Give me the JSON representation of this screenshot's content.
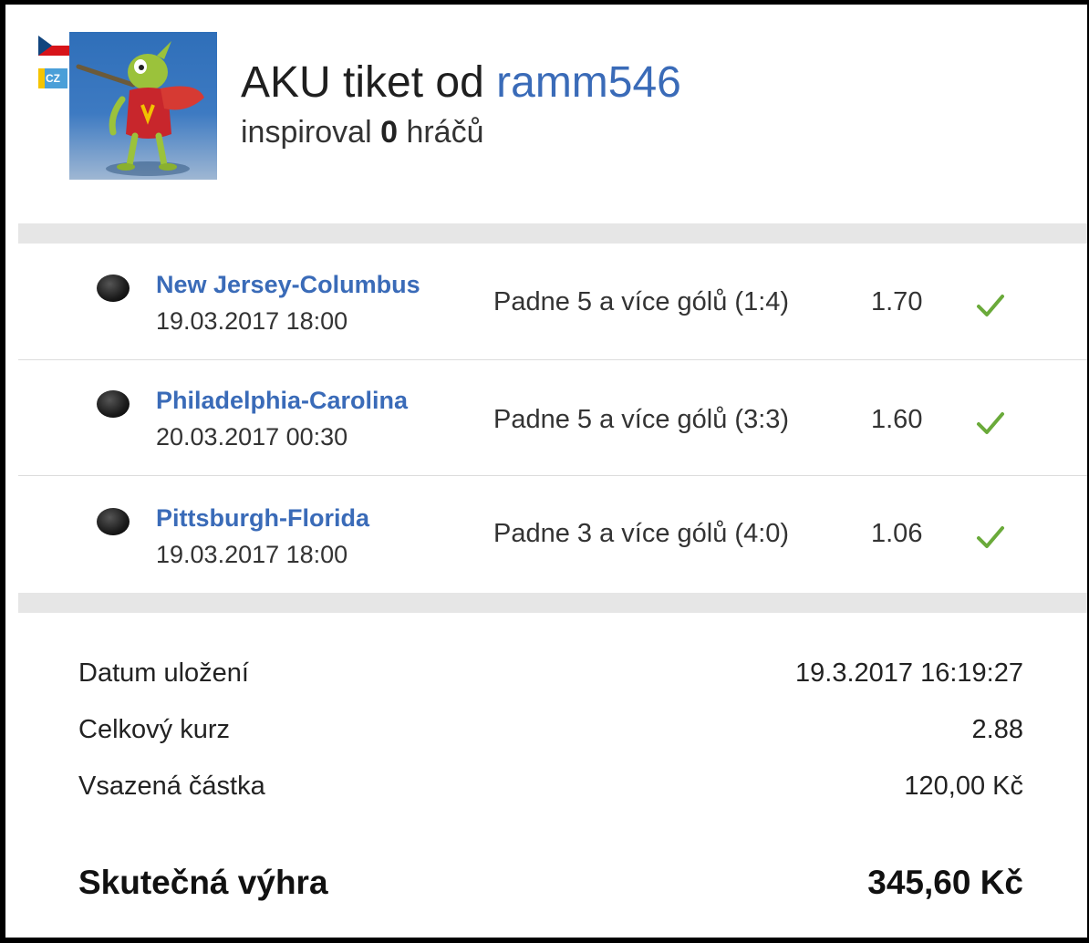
{
  "header": {
    "country_badge": "CZ",
    "title_prefix": "AKU tiket od",
    "username": "ramm546",
    "inspired_prefix": "inspiroval",
    "inspired_count": "0",
    "inspired_suffix": "hráčů"
  },
  "bets": [
    {
      "match": "New Jersey-Columbus",
      "datetime": "19.03.2017 18:00",
      "market": "Padne 5 a více gólů (1:4)",
      "odd": "1.70",
      "status_icon": "check-icon"
    },
    {
      "match": "Philadelphia-Carolina",
      "datetime": "20.03.2017 00:30",
      "market": "Padne 5 a více gólů (3:3)",
      "odd": "1.60",
      "status_icon": "check-icon"
    },
    {
      "match": "Pittsburgh-Florida",
      "datetime": "19.03.2017 18:00",
      "market": "Padne 3 a více gólů (4:0)",
      "odd": "1.06",
      "status_icon": "check-icon"
    }
  ],
  "summary": {
    "saved_date_label": "Datum uložení",
    "saved_date_value": "19.3.2017 16:19:27",
    "total_odds_label": "Celkový kurz",
    "total_odds_value": "2.88",
    "stake_label": "Vsazená částka",
    "stake_value": "120,00 Kč",
    "win_label": "Skutečná výhra",
    "win_value": "345,60 Kč"
  },
  "colors": {
    "link": "#3a6bb8",
    "check": "#6aaa3a",
    "divider_bar": "#e6e6e6"
  }
}
